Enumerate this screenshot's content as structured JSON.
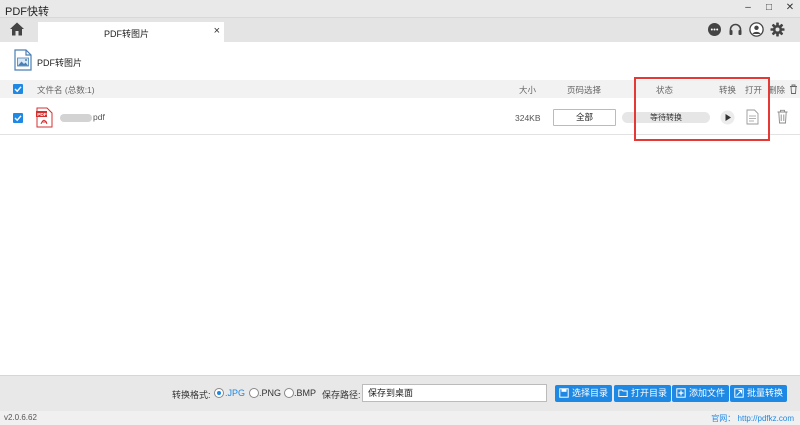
{
  "window": {
    "title": "PDF快转",
    "minimize_glyph": "–",
    "maximize_glyph": "□",
    "close_glyph": "✕"
  },
  "tabs": [
    {
      "label": "PDF转图片",
      "close_glyph": "×"
    }
  ],
  "toolbar_icons": [
    "chat-icon",
    "headset-icon",
    "user-icon",
    "gear-icon"
  ],
  "page": {
    "title": "PDF转图片"
  },
  "table": {
    "headers": {
      "filename": "文件名 (总数:1)",
      "size": "大小",
      "page_select": "页码选择",
      "status": "状态",
      "convert": "转换",
      "open": "打开",
      "delete": "删除"
    },
    "rows": [
      {
        "filename": "pdf",
        "size": "324KB",
        "page_select": "全部",
        "status": "等待转换"
      }
    ]
  },
  "bottom": {
    "format_label": "转换格式:",
    "formats": [
      ".JPG",
      ".PNG",
      ".BMP"
    ],
    "selected_format": ".JPG",
    "save_path_label": "保存路径:",
    "save_path_value": "保存到桌面",
    "buttons": {
      "choose_dir": "选择目录",
      "open_dir": "打开目录",
      "add_file": "添加文件",
      "batch_convert": "批量转换"
    }
  },
  "statusbar": {
    "version": "v2.0.6.62",
    "website": "官网：  http://pdfkz.com"
  },
  "colors": {
    "accent": "#1e88e5",
    "highlight": "#e53935",
    "pdf_red": "#d32f2f"
  }
}
